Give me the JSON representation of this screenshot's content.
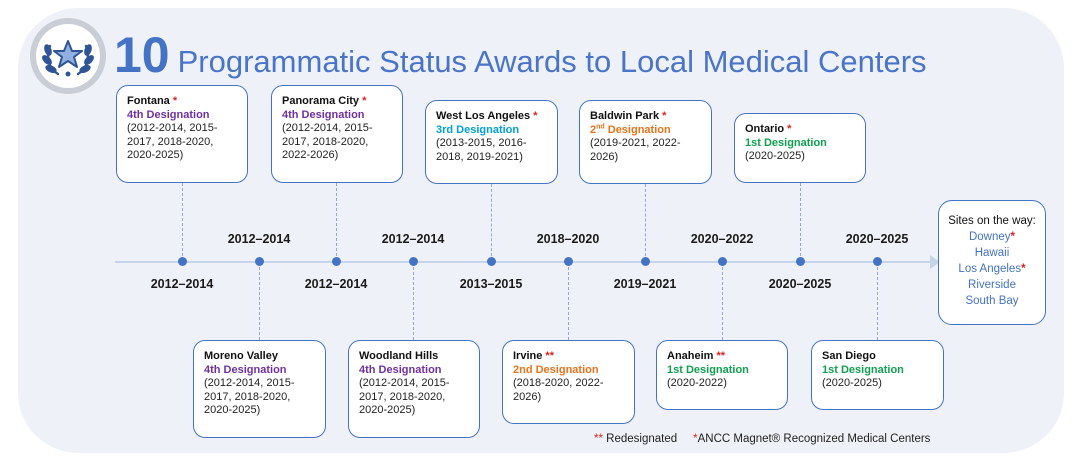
{
  "title": {
    "number": "10",
    "text": "Programmatic Status Awards to Local Medical Centers"
  },
  "badge_icon": "laurel-star-icon",
  "dates_above": [
    "2012–2014",
    "2012–2014",
    "2018–2020",
    "2020–2022",
    "2020–2025"
  ],
  "dates_below": [
    "2012–2014",
    "2012–2014",
    "2013–2015",
    "2019–2021",
    "2020–2025"
  ],
  "top_cards": [
    {
      "name": "Fontana",
      "mark": "*",
      "designation": "4th Designation",
      "level": "4",
      "years": "(2012-2014, 2015-2017, 2018-2020, 2020-2025)"
    },
    {
      "name": "Panorama City",
      "mark": "*",
      "designation": "4th Designation",
      "level": "4",
      "years": "(2012-2014, 2015-2017, 2018-2020, 2022-2026)"
    },
    {
      "name": "West Los Angeles",
      "mark": "*",
      "designation": "3rd Designation",
      "level": "3",
      "years": "(2013-2015, 2016-2018, 2019-2021)"
    },
    {
      "name": "Baldwin Park",
      "mark": "*",
      "designation_num": "2",
      "designation_sup": "nd",
      "designation_rest": " Designation",
      "level": "2",
      "years": "(2019-2021, 2022-2026)"
    },
    {
      "name": "Ontario",
      "mark": "*",
      "designation": "1st Designation",
      "level": "1",
      "years": "(2020-2025)"
    }
  ],
  "bottom_cards": [
    {
      "name": "Moreno Valley",
      "mark": "",
      "designation": "4th Designation",
      "level": "4",
      "years": "(2012-2014, 2015-2017, 2018-2020, 2020-2025)"
    },
    {
      "name": "Woodland Hills",
      "mark": "",
      "designation": "4th Designation",
      "level": "4",
      "years": "(2012-2014, 2015-2017, 2018-2020, 2020-2025)"
    },
    {
      "name": "Irvine",
      "mark": "**",
      "designation": "2nd Designation",
      "level": "2",
      "years": "(2018-2020, 2022-2026)"
    },
    {
      "name": "Anaheim",
      "mark": "**",
      "designation": "1st Designation",
      "level": "1",
      "years": "(2020-2022)"
    },
    {
      "name": "San Diego",
      "mark": "",
      "designation": "1st Designation",
      "level": "1",
      "years": "(2020-2025)"
    }
  ],
  "sites": {
    "title": "Sites on the way:",
    "items": [
      {
        "label": "Downey",
        "mark": "*"
      },
      {
        "label": "Hawaii",
        "mark": ""
      },
      {
        "label": "Los Angeles",
        "mark": "*"
      },
      {
        "label": "Riverside",
        "mark": ""
      },
      {
        "label": "South Bay",
        "mark": ""
      }
    ]
  },
  "legend": {
    "redesignated_mark": "**",
    "redesignated_label": "Redesignated",
    "magnet_mark": "*",
    "magnet_label": "ANCC Magnet® Recognized Medical Centers"
  },
  "colors": {
    "accent": "#4472c4",
    "d4": "#7030a0",
    "d3": "#00a0d6",
    "d2": "#e8731c",
    "d1": "#10a050",
    "mark": "#e02020"
  }
}
